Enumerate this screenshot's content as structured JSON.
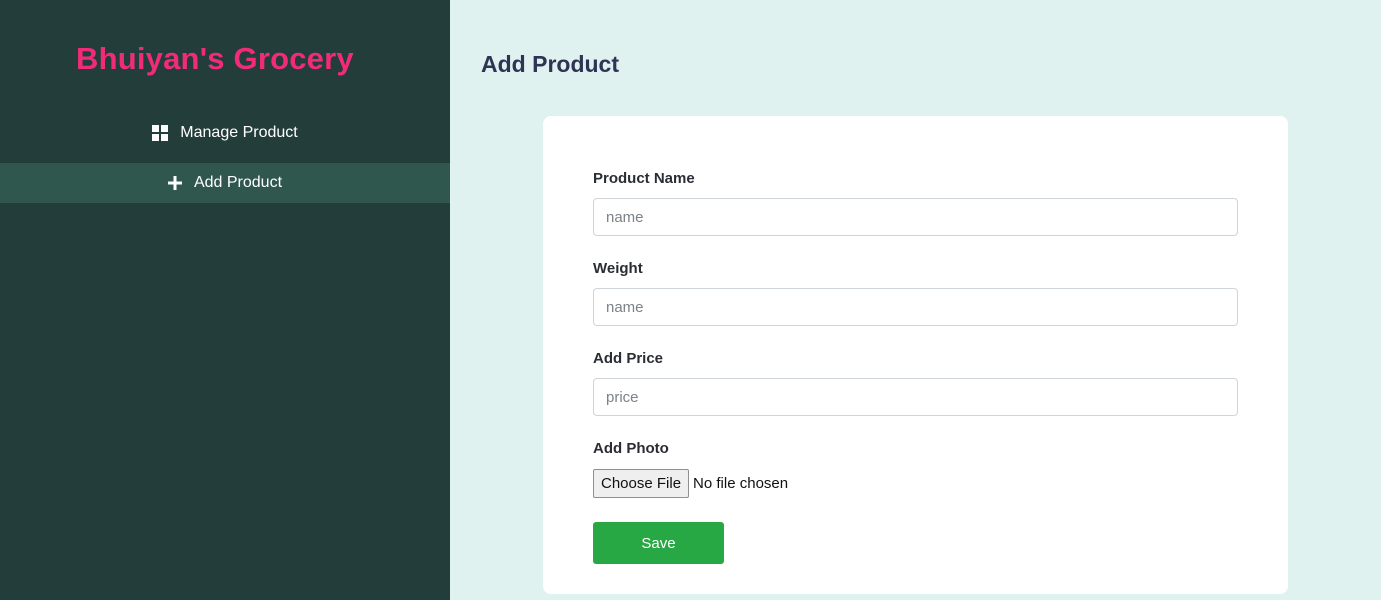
{
  "sidebar": {
    "brand": "Bhuiyan's Grocery",
    "items": [
      {
        "label": "Manage Product",
        "icon": "grid-icon",
        "active": false
      },
      {
        "label": "Add Product",
        "icon": "plus-icon",
        "active": true
      }
    ]
  },
  "main": {
    "title": "Add Product",
    "form": {
      "product_name": {
        "label": "Product Name",
        "placeholder": "name",
        "value": ""
      },
      "weight": {
        "label": "Weight",
        "placeholder": "name",
        "value": ""
      },
      "price": {
        "label": "Add Price",
        "placeholder": "price",
        "value": ""
      },
      "photo": {
        "label": "Add Photo",
        "button_label": "Choose File",
        "status": "No file chosen"
      },
      "save_label": "Save"
    }
  },
  "colors": {
    "sidebar_bg": "#233d3a",
    "sidebar_active_bg": "#2f574e",
    "brand": "#f22b79",
    "main_bg": "#e0f2f0",
    "save_button": "#28a745",
    "title": "#2f3454"
  }
}
